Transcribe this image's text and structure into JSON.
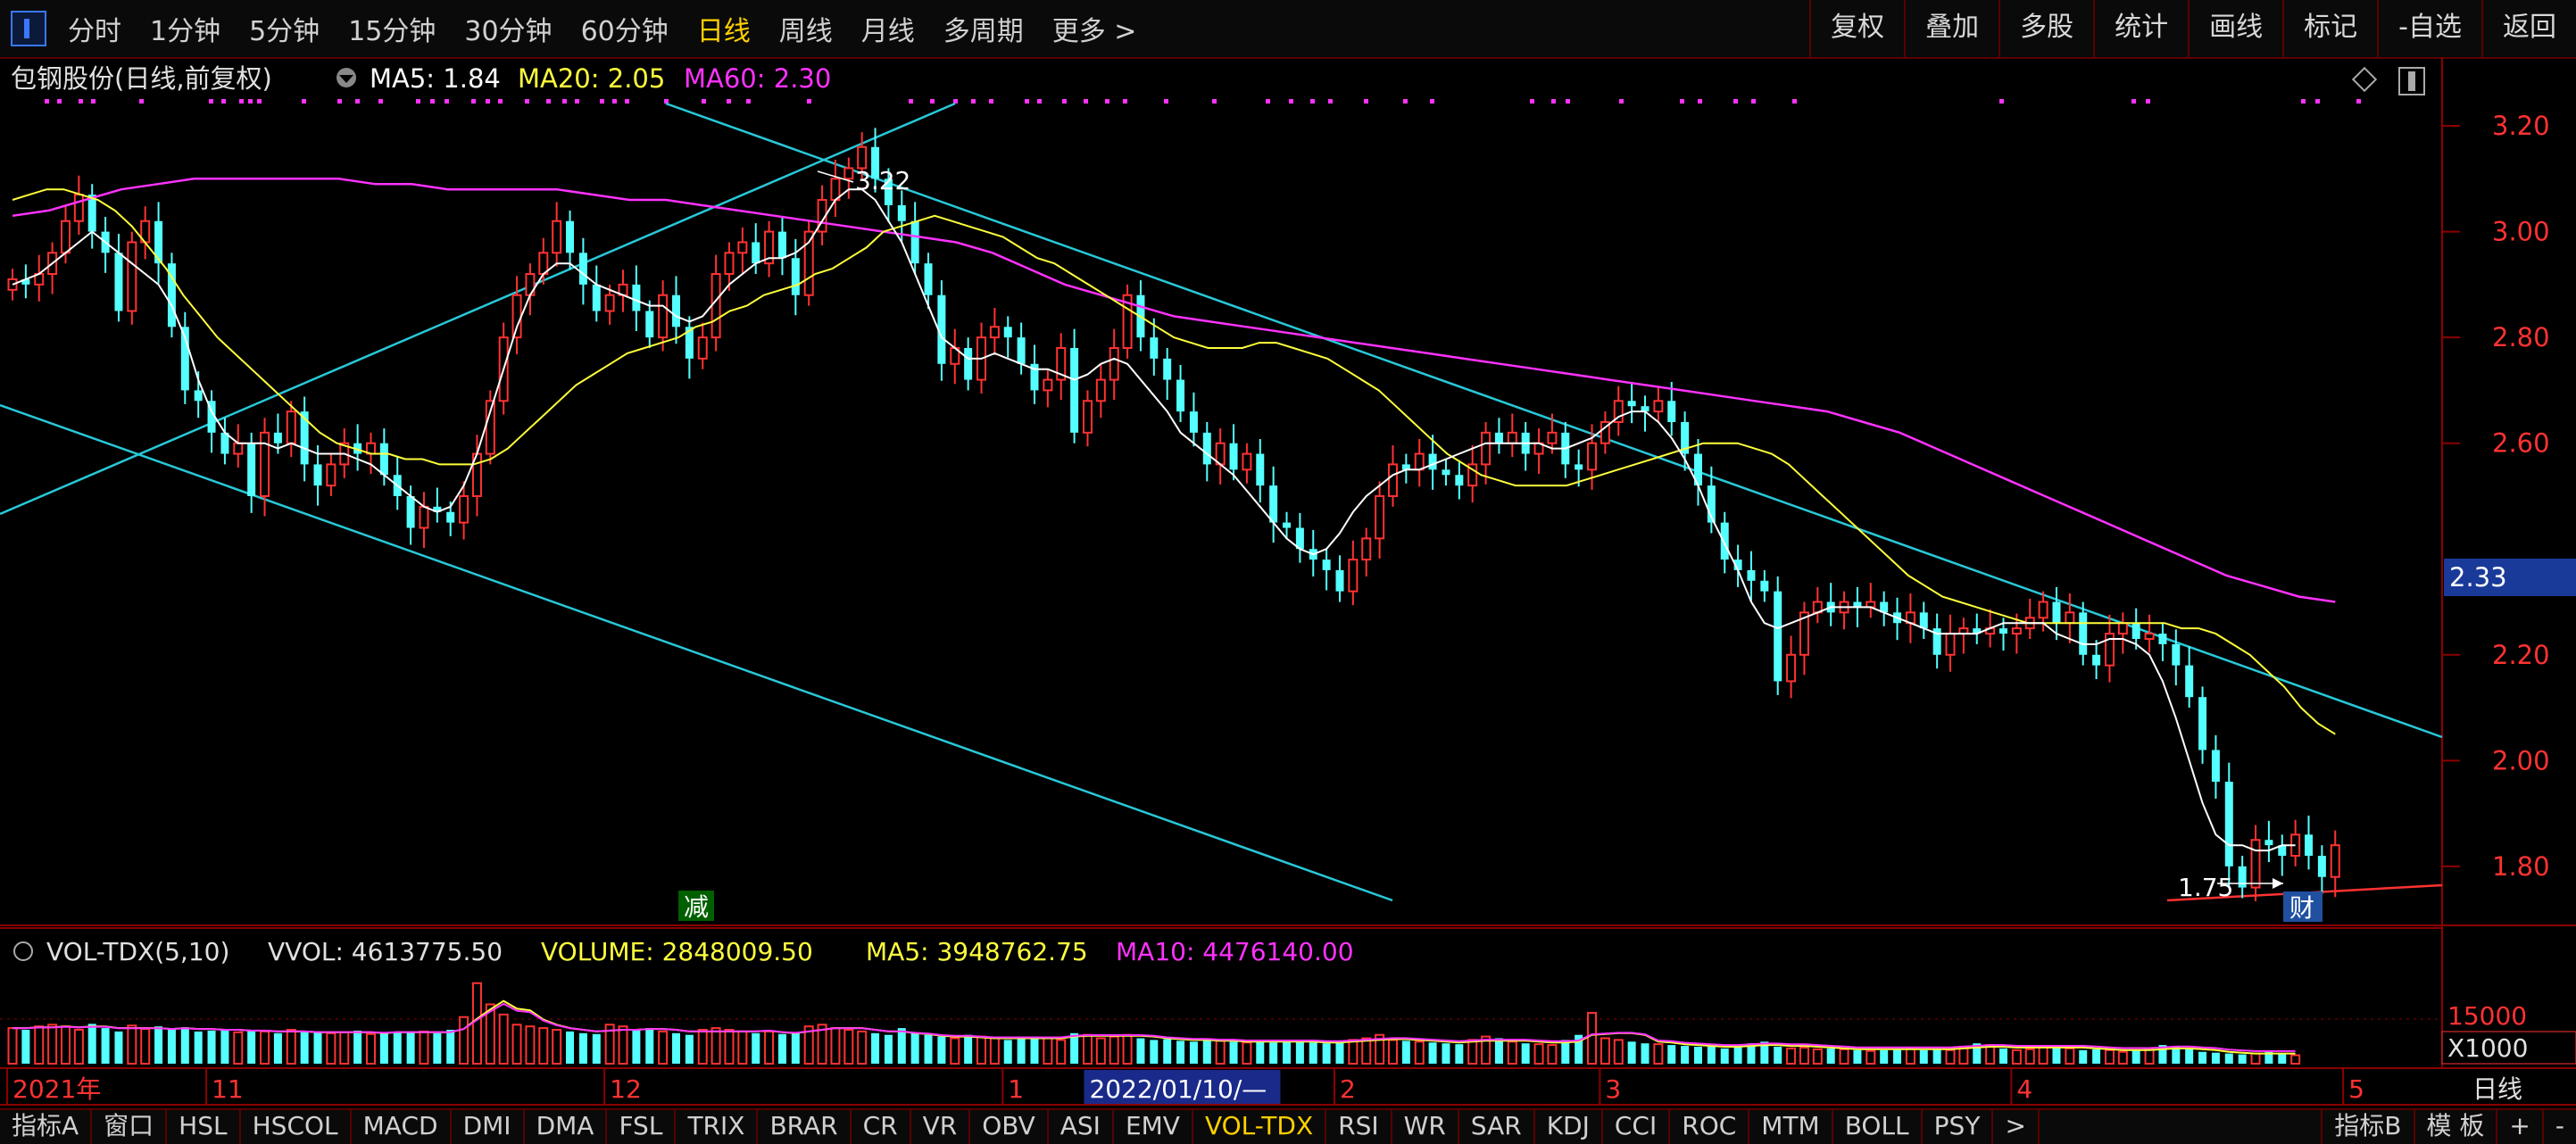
{
  "toolbar": {
    "periods": [
      "分时",
      "1分钟",
      "5分钟",
      "15分钟",
      "30分钟",
      "60分钟",
      "日线",
      "周线",
      "月线",
      "多周期",
      "更多 >"
    ],
    "active_period": "日线",
    "right_buttons": [
      "复权",
      "叠加",
      "多股",
      "统计",
      "画线",
      "标记",
      "-自选",
      "返回"
    ]
  },
  "colors": {
    "up": "#ff3232",
    "down": "#54ffff",
    "ma5": "#ffffff",
    "ma20": "#ffff3c",
    "ma60": "#ff32ff",
    "grid": "#8b0000",
    "trend": "#28c8d8"
  },
  "header": {
    "stock": "包钢股份(日线,前复权)",
    "ma5": "MA5: 1.84",
    "ma20": "MA20: 2.05",
    "ma60": "MA60: 2.30"
  },
  "vol_header": {
    "name": "VOL-TDX(5,10)",
    "vvol": "VVOL: 4613775.50",
    "volume": "VOLUME: 2848009.50",
    "ma5": "MA5: 3948762.75",
    "ma10": "MA10: 4476140.00"
  },
  "annotations": {
    "high_label": "3.22",
    "low_label": "1.75",
    "cut_marker": "减",
    "fin_marker": "财"
  },
  "date_axis": {
    "labels": [
      {
        "text": "2021年",
        "i": 0
      },
      {
        "text": "11",
        "i": 15
      },
      {
        "text": "12",
        "i": 45
      },
      {
        "text": "1",
        "i": 75
      },
      {
        "text": "2022/01/10/—",
        "i": 81
      },
      {
        "text": "2",
        "i": 100
      },
      {
        "text": "3",
        "i": 120
      },
      {
        "text": "4",
        "i": 151
      },
      {
        "text": "5",
        "i": 176
      }
    ],
    "right_label": "日线"
  },
  "chart_data": {
    "type": "candlestick",
    "ylim": [
      1.68,
      3.33
    ],
    "yticks": [
      "3.20",
      "3.00",
      "2.80",
      "2.60",
      "2.20",
      "2.00",
      "1.80"
    ],
    "current_price": "2.33",
    "vol_ticks": [
      "15000",
      "X1000"
    ],
    "highlight_index": 173,
    "close": [
      2.91,
      2.9,
      2.92,
      2.96,
      3.02,
      3.07,
      3.0,
      2.96,
      2.85,
      2.98,
      3.02,
      2.94,
      2.82,
      2.7,
      2.68,
      2.62,
      2.58,
      2.6,
      2.5,
      2.62,
      2.6,
      2.66,
      2.56,
      2.52,
      2.56,
      2.6,
      2.58,
      2.6,
      2.54,
      2.5,
      2.44,
      2.48,
      2.47,
      2.45,
      2.5,
      2.58,
      2.68,
      2.8,
      2.88,
      2.92,
      2.96,
      3.02,
      2.96,
      2.9,
      2.85,
      2.88,
      2.9,
      2.85,
      2.8,
      2.88,
      2.82,
      2.76,
      2.8,
      2.92,
      2.96,
      2.98,
      2.94,
      3.0,
      2.95,
      2.88,
      3.0,
      3.06,
      3.1,
      3.12,
      3.16,
      3.1,
      3.05,
      3.02,
      2.94,
      2.88,
      2.75,
      2.78,
      2.72,
      2.8,
      2.82,
      2.8,
      2.75,
      2.7,
      2.72,
      2.78,
      2.62,
      2.68,
      2.72,
      2.78,
      2.88,
      2.8,
      2.76,
      2.72,
      2.66,
      2.62,
      2.56,
      2.6,
      2.55,
      2.58,
      2.52,
      2.45,
      2.44,
      2.4,
      2.38,
      2.36,
      2.32,
      2.38,
      2.42,
      2.5,
      2.56,
      2.55,
      2.58,
      2.55,
      2.54,
      2.52,
      2.56,
      2.62,
      2.6,
      2.62,
      2.58,
      2.6,
      2.62,
      2.56,
      2.55,
      2.6,
      2.64,
      2.68,
      2.67,
      2.66,
      2.68,
      2.64,
      2.58,
      2.52,
      2.45,
      2.38,
      2.36,
      2.34,
      2.32,
      2.15,
      2.2,
      2.28,
      2.3,
      2.28,
      2.3,
      2.29,
      2.3,
      2.28,
      2.26,
      2.28,
      2.25,
      2.2,
      2.24,
      2.25,
      2.24,
      2.25,
      2.24,
      2.25,
      2.27,
      2.3,
      2.26,
      2.28,
      2.2,
      2.18,
      2.24,
      2.26,
      2.23,
      2.24,
      2.22,
      2.18,
      2.12,
      2.02,
      1.96,
      1.8,
      1.76,
      1.85,
      1.84,
      1.82,
      1.86,
      1.82,
      1.78,
      1.84
    ],
    "ma5": [
      2.9,
      2.91,
      2.92,
      2.94,
      2.96,
      2.98,
      3.0,
      2.98,
      2.96,
      2.94,
      2.92,
      2.9,
      2.86,
      2.8,
      2.72,
      2.66,
      2.62,
      2.6,
      2.6,
      2.6,
      2.59,
      2.6,
      2.59,
      2.58,
      2.58,
      2.58,
      2.57,
      2.56,
      2.54,
      2.52,
      2.5,
      2.48,
      2.47,
      2.48,
      2.52,
      2.58,
      2.66,
      2.74,
      2.82,
      2.88,
      2.92,
      2.94,
      2.94,
      2.92,
      2.9,
      2.89,
      2.88,
      2.87,
      2.86,
      2.86,
      2.84,
      2.83,
      2.84,
      2.87,
      2.9,
      2.92,
      2.94,
      2.95,
      2.95,
      2.96,
      2.98,
      3.02,
      3.06,
      3.08,
      3.08,
      3.06,
      3.02,
      2.98,
      2.92,
      2.86,
      2.8,
      2.78,
      2.76,
      2.76,
      2.77,
      2.76,
      2.75,
      2.74,
      2.74,
      2.73,
      2.72,
      2.73,
      2.75,
      2.76,
      2.75,
      2.72,
      2.69,
      2.66,
      2.62,
      2.6,
      2.58,
      2.56,
      2.54,
      2.51,
      2.48,
      2.45,
      2.42,
      2.4,
      2.39,
      2.4,
      2.43,
      2.47,
      2.5,
      2.52,
      2.54,
      2.55,
      2.55,
      2.56,
      2.57,
      2.58,
      2.59,
      2.6,
      2.6,
      2.6,
      2.6,
      2.6,
      2.59,
      2.59,
      2.6,
      2.61,
      2.63,
      2.65,
      2.66,
      2.66,
      2.64,
      2.61,
      2.57,
      2.52,
      2.46,
      2.41,
      2.36,
      2.3,
      2.26,
      2.25,
      2.26,
      2.27,
      2.28,
      2.29,
      2.29,
      2.29,
      2.29,
      2.28,
      2.27,
      2.26,
      2.25,
      2.24,
      2.24,
      2.24,
      2.24,
      2.25,
      2.26,
      2.26,
      2.26,
      2.26,
      2.24,
      2.23,
      2.22,
      2.22,
      2.23,
      2.23,
      2.22,
      2.2,
      2.15,
      2.08,
      2.0,
      1.92,
      1.86,
      1.84,
      1.84,
      1.83,
      1.83,
      1.84,
      1.84
    ],
    "ma20": [
      3.06,
      3.07,
      3.08,
      3.08,
      3.07,
      3.06,
      3.04,
      3.01,
      2.97,
      2.93,
      2.88,
      2.84,
      2.8,
      2.77,
      2.74,
      2.71,
      2.68,
      2.65,
      2.62,
      2.6,
      2.59,
      2.58,
      2.58,
      2.57,
      2.57,
      2.56,
      2.56,
      2.56,
      2.57,
      2.59,
      2.62,
      2.65,
      2.68,
      2.71,
      2.73,
      2.75,
      2.77,
      2.78,
      2.79,
      2.8,
      2.82,
      2.83,
      2.85,
      2.86,
      2.88,
      2.89,
      2.9,
      2.92,
      2.93,
      2.95,
      2.97,
      3.0,
      3.01,
      3.02,
      3.03,
      3.02,
      3.01,
      3.0,
      2.99,
      2.97,
      2.95,
      2.94,
      2.92,
      2.9,
      2.88,
      2.86,
      2.84,
      2.82,
      2.8,
      2.79,
      2.78,
      2.78,
      2.78,
      2.79,
      2.79,
      2.78,
      2.77,
      2.76,
      2.74,
      2.72,
      2.7,
      2.67,
      2.64,
      2.61,
      2.58,
      2.56,
      2.54,
      2.53,
      2.52,
      2.52,
      2.52,
      2.52,
      2.53,
      2.54,
      2.55,
      2.56,
      2.57,
      2.58,
      2.59,
      2.6,
      2.6,
      2.6,
      2.59,
      2.58,
      2.56,
      2.53,
      2.5,
      2.47,
      2.44,
      2.41,
      2.38,
      2.35,
      2.33,
      2.31,
      2.3,
      2.29,
      2.28,
      2.27,
      2.26,
      2.26,
      2.26,
      2.26,
      2.26,
      2.26,
      2.26,
      2.26,
      2.26,
      2.25,
      2.25,
      2.24,
      2.22,
      2.2,
      2.17,
      2.14,
      2.1,
      2.07,
      2.05
    ],
    "ma60": [
      3.03,
      3.04,
      3.06,
      3.08,
      3.09,
      3.1,
      3.1,
      3.1,
      3.1,
      3.1,
      3.09,
      3.09,
      3.08,
      3.08,
      3.08,
      3.08,
      3.07,
      3.06,
      3.06,
      3.05,
      3.04,
      3.03,
      3.02,
      3.01,
      3.0,
      2.99,
      2.98,
      2.96,
      2.93,
      2.9,
      2.88,
      2.86,
      2.84,
      2.83,
      2.82,
      2.81,
      2.8,
      2.79,
      2.78,
      2.77,
      2.76,
      2.75,
      2.74,
      2.73,
      2.72,
      2.71,
      2.7,
      2.69,
      2.68,
      2.67,
      2.66,
      2.64,
      2.62,
      2.59,
      2.56,
      2.53,
      2.5,
      2.47,
      2.44,
      2.41,
      2.38,
      2.35,
      2.33,
      2.31,
      2.3
    ],
    "volume": [
      42,
      40,
      44,
      46,
      44,
      40,
      47,
      42,
      38,
      45,
      41,
      44,
      40,
      43,
      38,
      39,
      41,
      37,
      40,
      38,
      36,
      40,
      37,
      38,
      36,
      37,
      39,
      35,
      36,
      38,
      37,
      38,
      36,
      40,
      55,
      95,
      70,
      58,
      46,
      44,
      42,
      40,
      38,
      36,
      35,
      46,
      44,
      40,
      42,
      38,
      36,
      34,
      40,
      42,
      40,
      38,
      36,
      38,
      35,
      36,
      44,
      46,
      42,
      40,
      38,
      36,
      34,
      42,
      36,
      34,
      32,
      30,
      34,
      32,
      30,
      28,
      30,
      32,
      30,
      28,
      36,
      34,
      30,
      32,
      34,
      30,
      28,
      29,
      27,
      26,
      28,
      27,
      26,
      25,
      26,
      25,
      27,
      26,
      25,
      24,
      26,
      28,
      30,
      34,
      28,
      27,
      26,
      25,
      24,
      23,
      28,
      32,
      30,
      26,
      24,
      23,
      22,
      28,
      34,
      60,
      30,
      28,
      26,
      24,
      23,
      22,
      21,
      20,
      20,
      18,
      22,
      24,
      26,
      20,
      18,
      19,
      17,
      18,
      17,
      16,
      15,
      16,
      17,
      18,
      16,
      18,
      16,
      20,
      24,
      22,
      18,
      16,
      17,
      20,
      22,
      18,
      16,
      17,
      16,
      14,
      16,
      18,
      22,
      20,
      18,
      14,
      13,
      12,
      11,
      12,
      14,
      12,
      10
    ],
    "vol_ma5": [
      42,
      42,
      43,
      43,
      44,
      43,
      44,
      44,
      42,
      42,
      42,
      42,
      41,
      42,
      41,
      41,
      40,
      40,
      39,
      39,
      38,
      38,
      38,
      37,
      37,
      37,
      37,
      37,
      36,
      37,
      37,
      37,
      37,
      37,
      41,
      53,
      64,
      74,
      65,
      63,
      52,
      46,
      42,
      40,
      38,
      39,
      40,
      40,
      41,
      41,
      40,
      38,
      38,
      38,
      38,
      38,
      38,
      39,
      37,
      36,
      38,
      40,
      42,
      42,
      42,
      40,
      38,
      38,
      36,
      35,
      33,
      32,
      32,
      31,
      30,
      30,
      30,
      30,
      30,
      30,
      32,
      33,
      33,
      33,
      33,
      33,
      32,
      30,
      29,
      28,
      28,
      27,
      27,
      26,
      26,
      26,
      26,
      26,
      26,
      25,
      25,
      26,
      27,
      28,
      29,
      29,
      28,
      27,
      26,
      25,
      26,
      27,
      27,
      27,
      27,
      26,
      25,
      25,
      26,
      34,
      35,
      36,
      36,
      34,
      26,
      25,
      23,
      22,
      21,
      20,
      20,
      21,
      22,
      22,
      21,
      21,
      20,
      19,
      18,
      17,
      17,
      17,
      17,
      17,
      17,
      17,
      17,
      18,
      19,
      20,
      20,
      19,
      19,
      19,
      19,
      19,
      19,
      18,
      17,
      16,
      16,
      16,
      17,
      18,
      18,
      17,
      16,
      14,
      13,
      12,
      12,
      12,
      12
    ]
  }
}
